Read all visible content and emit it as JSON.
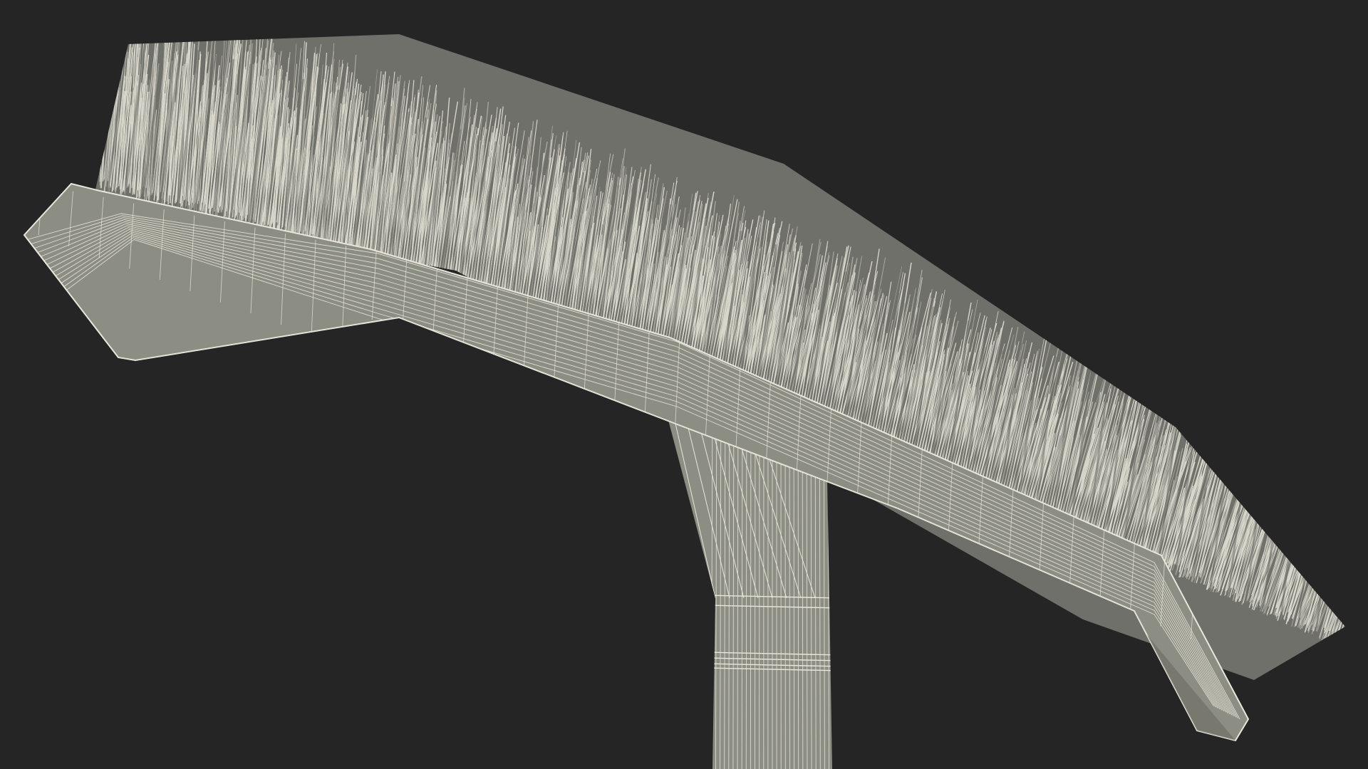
{
  "scene": {
    "subject": "brush-wireframe-render",
    "colors": {
      "background": "#252525",
      "mesh_fill": "#8c8d83",
      "mesh_shadow": "#6a6b63",
      "wire": "#e9e7dc",
      "bristle": "#d9d7cc",
      "bristle_dark": "#6f706a"
    }
  }
}
